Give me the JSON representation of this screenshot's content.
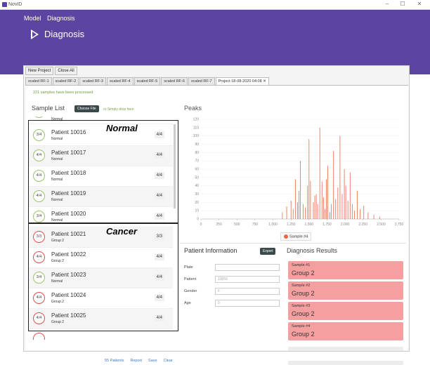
{
  "window": {
    "app_name": "NovID",
    "minimize": "–",
    "maximize": "☐",
    "close": "✕"
  },
  "menu": {
    "items": [
      "Model",
      "Diagnosis"
    ]
  },
  "header": {
    "title": "Diagnosis"
  },
  "toolbar": {
    "new_project": "New Project",
    "close_all": "Close All"
  },
  "tabs": [
    "scaled RF-1",
    "scaled RF-2",
    "scaled RF-3",
    "scaled RF-4",
    "scaled RF-5",
    "scaled RF-6",
    "scaled RF-7",
    "Project 18-08-2020 04:08 ✕"
  ],
  "status": {
    "processed": "221 samples have been processed"
  },
  "sample_list": {
    "title": "Sample List",
    "choose_file": "Choose File",
    "drop_hint": "or Simply drop here",
    "partial_top": "Normal",
    "rows": [
      {
        "badge": "3/4",
        "name": "Patient 10016",
        "diagnosis": "Normal",
        "count": "4/4",
        "status": "green"
      },
      {
        "badge": "4/4",
        "name": "Patient 10017",
        "diagnosis": "Normal",
        "count": "4/4",
        "status": "green"
      },
      {
        "badge": "4/4",
        "name": "Patient 10018",
        "diagnosis": "Normal",
        "count": "4/4",
        "status": "green"
      },
      {
        "badge": "4/4",
        "name": "Patient 10019",
        "diagnosis": "Normal",
        "count": "4/4",
        "status": "green"
      },
      {
        "badge": "3/4",
        "name": "Patient 10020",
        "diagnosis": "Normal",
        "count": "4/4",
        "status": "green"
      },
      {
        "badge": "3/3",
        "name": "Patient 10021",
        "diagnosis": "Group 2",
        "count": "3/3",
        "status": "red"
      },
      {
        "badge": "4/4",
        "name": "Patient 10022",
        "diagnosis": "Group 2",
        "count": "4/4",
        "status": "red"
      },
      {
        "badge": "3/4",
        "name": "Patient 10023",
        "diagnosis": "Normal",
        "count": "4/4",
        "status": "green"
      },
      {
        "badge": "4/4",
        "name": "Patient 10024",
        "diagnosis": "Group 2",
        "count": "4/4",
        "status": "red"
      },
      {
        "badge": "4/4",
        "name": "Patient 10025",
        "diagnosis": "Group 2",
        "count": "4/4",
        "status": "red"
      }
    ],
    "annotation_normal": "Normal",
    "annotation_cancer": "Cancer",
    "footer": {
      "patients": "55 Patients",
      "report": "Report",
      "save": "Save",
      "clear": "Clear"
    }
  },
  "peaks": {
    "title": "Peaks",
    "legend": "Sample #4"
  },
  "chart_data": {
    "type": "bar",
    "title": "Peaks",
    "xlim": [
      0,
      2750
    ],
    "ylim": [
      0,
      120
    ],
    "x_ticks": [
      0,
      250,
      500,
      750,
      1000,
      1250,
      1500,
      1750,
      2000,
      2250,
      2500,
      2750
    ],
    "x_tick_labels": [
      "0",
      "250",
      "500",
      "750",
      "1,000",
      "1,250",
      "1,500",
      "1,750",
      "2,000",
      "2,250",
      "2,500",
      "2,750"
    ],
    "y_ticks": [
      0,
      10,
      20,
      30,
      40,
      50,
      60,
      70,
      80,
      90,
      100,
      110,
      120
    ],
    "series": [
      {
        "name": "Sample #4",
        "color": "#e8664a",
        "x": [
          1130,
          1190,
          1250,
          1280,
          1310,
          1340,
          1360,
          1380,
          1420,
          1450,
          1480,
          1500,
          1520,
          1560,
          1580,
          1600,
          1620,
          1650,
          1680,
          1700,
          1720,
          1740,
          1760,
          1790,
          1810,
          1840,
          1870,
          1900,
          1930,
          1960,
          1990,
          2010,
          2040,
          2070,
          2100,
          2130,
          2170,
          2210,
          2260,
          2320,
          2400,
          2480
        ],
        "y": [
          8,
          15,
          22,
          12,
          48,
          20,
          34,
          70,
          18,
          14,
          40,
          96,
          46,
          20,
          28,
          30,
          18,
          110,
          45,
          26,
          12,
          48,
          64,
          8,
          18,
          82,
          24,
          38,
          100,
          30,
          60,
          40,
          22,
          56,
          18,
          10,
          34,
          12,
          16,
          8,
          5,
          3
        ]
      }
    ]
  },
  "patient_info": {
    "title": "Patient Information",
    "export": "Export",
    "fields": [
      {
        "label": "Plate",
        "value": ""
      },
      {
        "label": "Patient",
        "value": "10059"
      },
      {
        "label": "Gender",
        "value": "F"
      },
      {
        "label": "Age",
        "value": "0"
      }
    ]
  },
  "diagnosis_results": {
    "title": "Diagnosis Results",
    "results": [
      {
        "sample": "Sample #1",
        "group": "Group 2"
      },
      {
        "sample": "Sample #2",
        "group": "Group 2"
      },
      {
        "sample": "Sample #3",
        "group": "Group 2"
      },
      {
        "sample": "Sample #4",
        "group": "Group 2"
      }
    ]
  }
}
